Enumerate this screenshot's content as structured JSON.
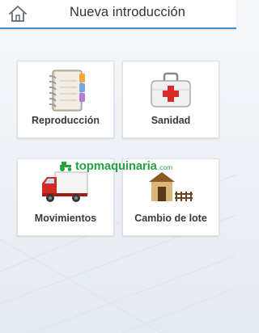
{
  "header": {
    "title": "Nueva introducción",
    "home_icon": "home-icon"
  },
  "menu": [
    {
      "label": "Reproducción",
      "icon": "notebook-icon"
    },
    {
      "label": "Sanidad",
      "icon": "first-aid-kit-icon"
    },
    {
      "label": "Movimientos",
      "icon": "truck-icon"
    },
    {
      "label": "Cambio de lote",
      "icon": "barn-icon"
    }
  ],
  "watermark": {
    "main": "topmaquinaria",
    "suffix": ".com"
  },
  "colors": {
    "header_rule": "#4a8bd0",
    "watermark": "#1e9e3e",
    "label_text": "#3a3a3a"
  }
}
